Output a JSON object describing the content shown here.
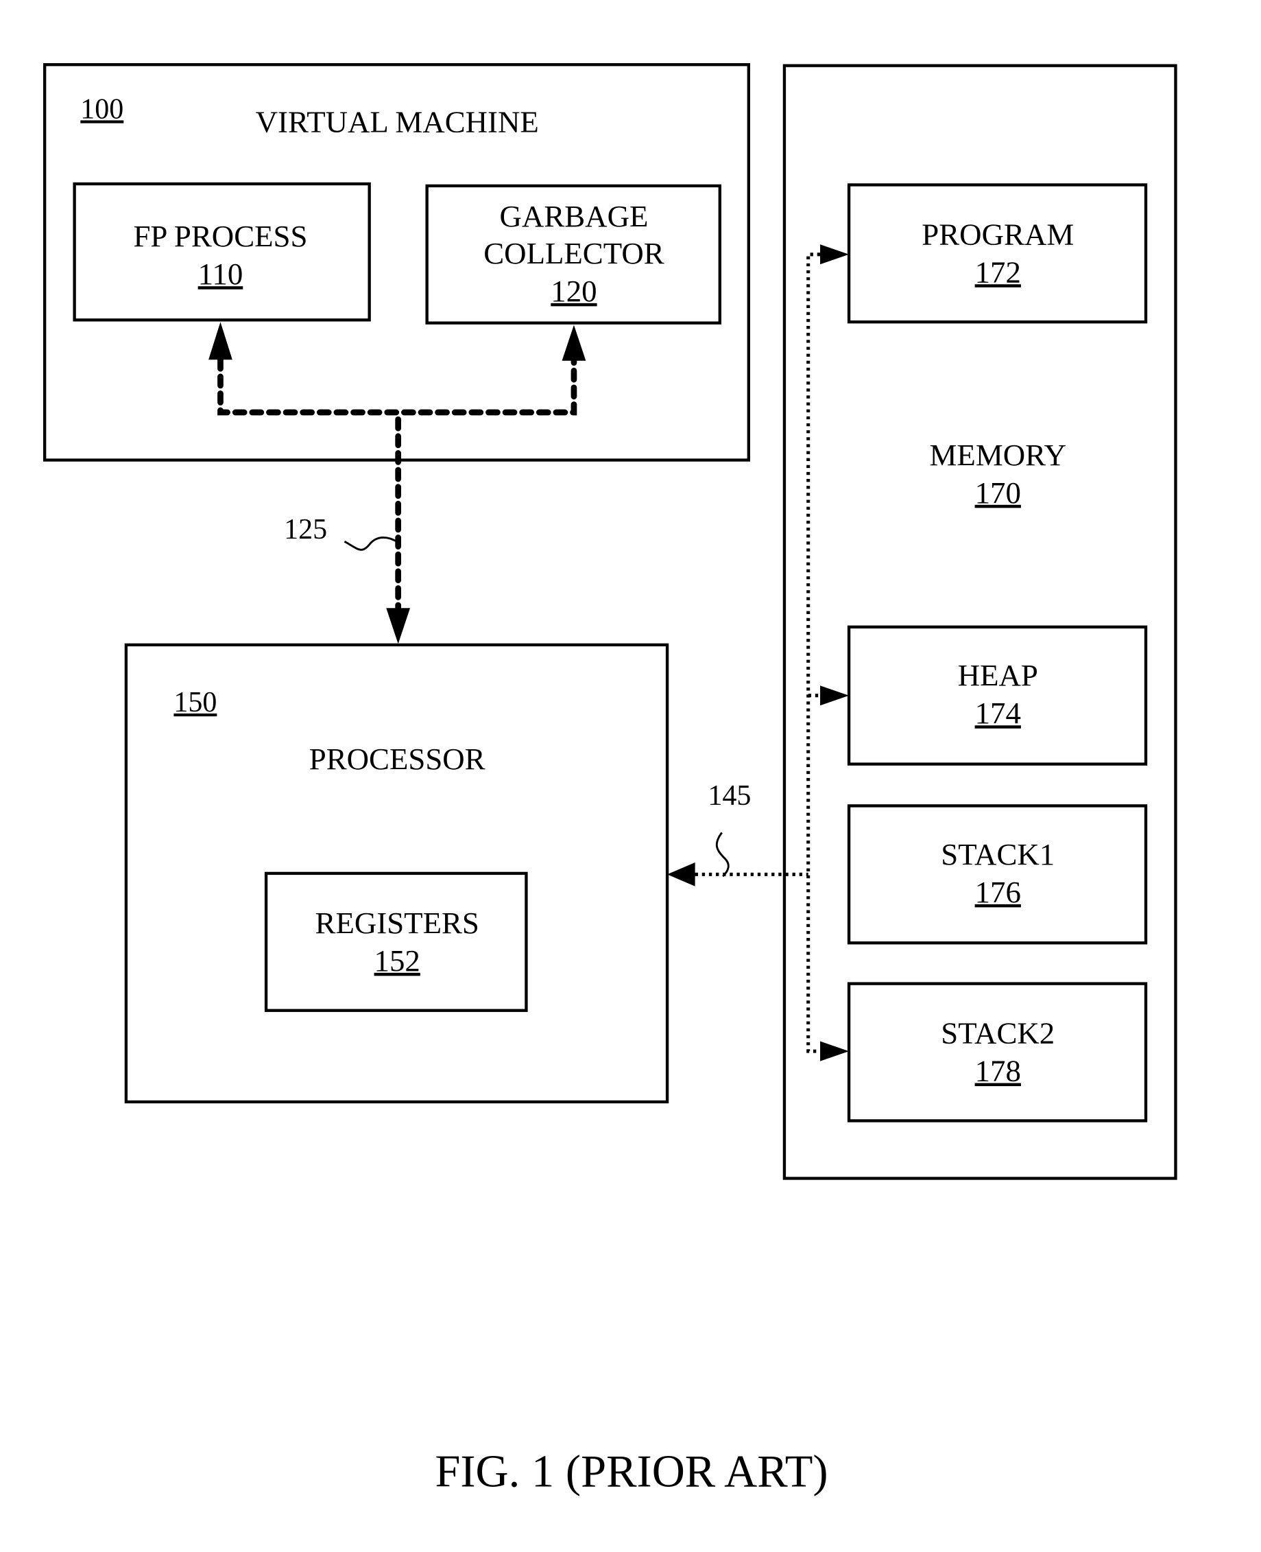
{
  "figure": {
    "caption": "FIG. 1 (PRIOR ART)",
    "virtual_machine": {
      "ref": "100",
      "label": "VIRTUAL MACHINE"
    },
    "fp_process": {
      "label": "FP PROCESS",
      "ref": "110"
    },
    "garbage_collector": {
      "label1": "GARBAGE",
      "label2": "COLLECTOR",
      "ref": "120"
    },
    "link_vm_processor": {
      "ref": "125"
    },
    "processor": {
      "ref": "150",
      "label": "PROCESSOR"
    },
    "registers": {
      "label": "REGISTERS",
      "ref": "152"
    },
    "link_memory_processor": {
      "ref": "145"
    },
    "memory": {
      "label": "MEMORY",
      "ref": "170"
    },
    "program": {
      "label": "PROGRAM",
      "ref": "172"
    },
    "heap": {
      "label": "HEAP",
      "ref": "174"
    },
    "stack1": {
      "label": "STACK1",
      "ref": "176"
    },
    "stack2": {
      "label": "STACK2",
      "ref": "178"
    }
  }
}
